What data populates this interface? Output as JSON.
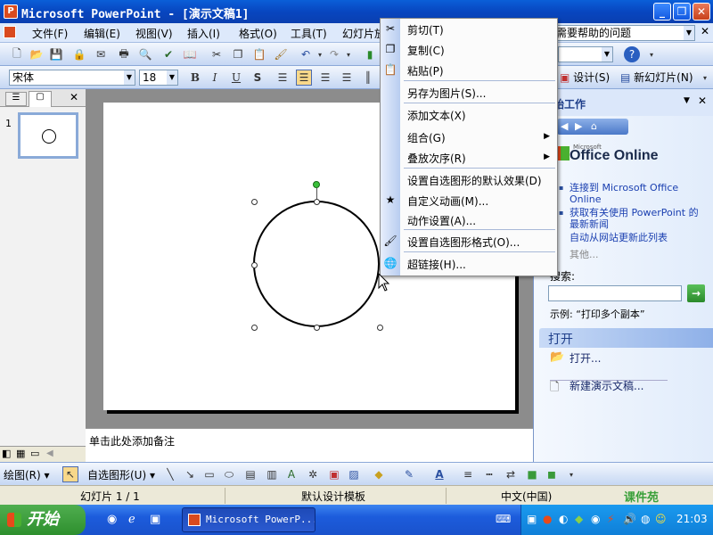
{
  "window": {
    "title": "Microsoft PowerPoint - [演示文稿1]",
    "app_icon": "P"
  },
  "menubar": {
    "items": [
      "文件(F)",
      "编辑(E)",
      "视图(V)",
      "插入(I)",
      "格式(O)",
      "工具(T)",
      "幻灯片放"
    ],
    "help_placeholder": "需要帮助的问题"
  },
  "format": {
    "font": "宋体",
    "size": "18"
  },
  "toolbar2": {
    "design": "设计(S)",
    "new_slide": "新幻灯片(N)"
  },
  "slide_thumb": {
    "number": "1"
  },
  "notes": {
    "placeholder": "单击此处添加备注"
  },
  "taskpane": {
    "title_partial": "始工作",
    "office_small": "Microsoft",
    "office_logo": "Office Online",
    "links": [
      "连接到 Microsoft Office Online",
      "获取有关使用 PowerPoint 的最新新闻",
      "自动从网站更新此列表"
    ],
    "more": "其他...",
    "search_label": "搜索:",
    "example": "示例:  “打印多个副本”",
    "open_header": "打开",
    "open_items": [
      "打开...",
      "新建演示文稿..."
    ]
  },
  "context_menu": {
    "items": [
      {
        "label": "剪切(T)",
        "icon": "scissors-icon",
        "glyph": "✂"
      },
      {
        "label": "复制(C)",
        "icon": "copy-icon",
        "glyph": "❐"
      },
      {
        "label": "粘贴(P)",
        "icon": "paste-icon",
        "glyph": "📋"
      },
      {
        "label": "另存为图片(S)..."
      },
      {
        "label": "添加文本(X)"
      },
      {
        "label": "组合(G)",
        "submenu": true
      },
      {
        "label": "叠放次序(R)",
        "submenu": true
      },
      {
        "label": "设置自选图形的默认效果(D)"
      },
      {
        "label": "自定义动画(M)...",
        "icon": "custom-animation-icon",
        "glyph": "★"
      },
      {
        "label": "动作设置(A)..."
      },
      {
        "label": "设置自选图形格式(O)...",
        "icon": "format-shape-icon",
        "glyph": "🖌"
      },
      {
        "label": "超链接(H)...",
        "icon": "hyperlink-icon",
        "glyph": "🌐"
      }
    ]
  },
  "drawbar": {
    "draw": "绘图(R)",
    "autoshape": "自选图形(U)"
  },
  "status": {
    "slide": "幻灯片 1 / 1",
    "template": "默认设计模板",
    "language": "中文(中国)",
    "watermark": "课件苑"
  },
  "taskbar": {
    "start": "开始",
    "task": "Microsoft PowerP...",
    "clock": "21:03"
  },
  "colors": {
    "titlebar": "#0a5fd8",
    "taskbar": "#1c5cdc",
    "start": "#3a9e3a"
  }
}
